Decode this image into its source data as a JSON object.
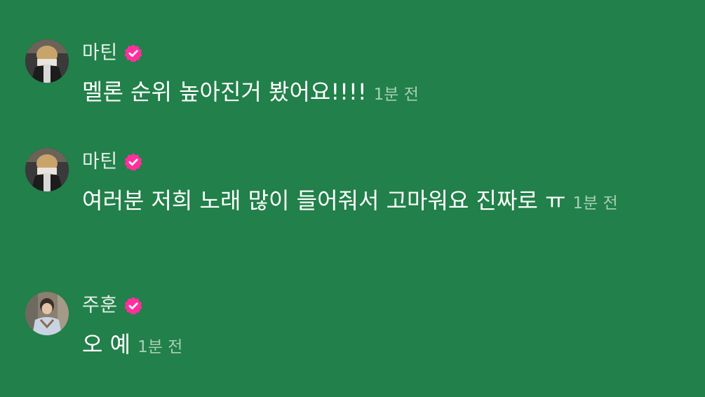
{
  "colors": {
    "background": "#22804a",
    "name": "#e6f1ea",
    "message_text": "#ffffff",
    "timestamp": "#a6d0b6",
    "verified_badge": "#ff2f9e"
  },
  "messages": [
    {
      "author": "마틴",
      "verified": true,
      "text": "멜론 순위 높아진거 봤어요!!!!",
      "time": "1분 전",
      "avatar_icon": "avatar-photo"
    },
    {
      "author": "마틴",
      "verified": true,
      "text": "여러분 저희 노래 많이 들어줘서 고마워요 진짜로 ㅠ",
      "time": "1분 전",
      "avatar_icon": "avatar-photo"
    },
    {
      "author": "주훈",
      "verified": true,
      "text": "오 예",
      "time": "1분 전",
      "avatar_icon": "avatar-photo"
    }
  ]
}
